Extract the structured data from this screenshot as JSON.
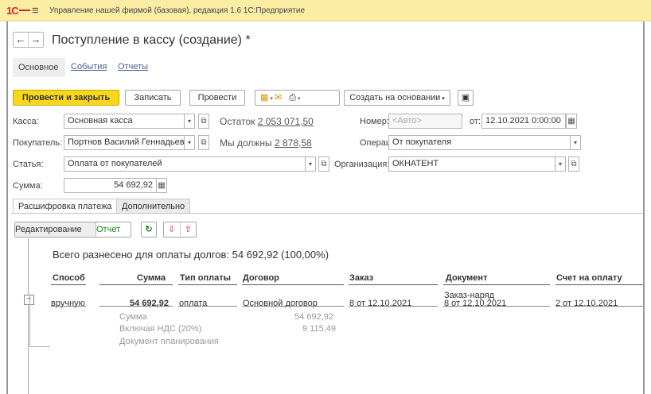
{
  "app": {
    "title": "Управление нашей фирмой (базовая), редакция 1.6 1С:Предприятие",
    "logo": "1С"
  },
  "nav": {
    "back": "←",
    "forward": "→"
  },
  "document": {
    "title": "Поступление в кассу (создание) *"
  },
  "tabs": [
    "Основное",
    "События",
    "Отчеты"
  ],
  "toolbar": {
    "post_close": "Провести и закрыть",
    "save": "Записать",
    "post": "Провести",
    "create_based": "Создать на основании"
  },
  "form": {
    "cash_label": "Касса:",
    "cash_value": "Основная касса",
    "balance_label": "Остаток",
    "balance_value": "2 053 071,50",
    "number_label": "Номер:",
    "number_placeholder": "<Авто>",
    "date_label": "от:",
    "date_value": "12.10.2021  0:00:00",
    "buyer_label": "Покупатель:",
    "buyer_value": "Портнов Василий Геннадьевич",
    "debt_label": "Мы должны",
    "debt_value": "2 878,58",
    "operation_label": "Операция:",
    "operation_value": "От покупателя",
    "item_label": "Статья:",
    "item_value": "Оплата от покупателей",
    "org_label": "Организация:",
    "org_value": "ОКНАТЕНТ",
    "sum_label": "Сумма:",
    "sum_value": "54 692,92"
  },
  "payment_tabs": [
    "Расшифровка платежа",
    "Дополнительно"
  ],
  "payment_toolbar": {
    "edit": "Редактирование",
    "report": "Отчет"
  },
  "allocation": {
    "summary": "Всего разнесено для оплаты долгов: 54 692,92  (100,00%)",
    "columns": [
      "Способ",
      "Сумма",
      "Тип оплаты",
      "Договор",
      "Заказ",
      "Документ",
      "Счет на оплату"
    ],
    "row": {
      "method": "вручную",
      "sum": "54 692,92",
      "pay_type": "оплата",
      "contract": "Основной договор",
      "order": "8 от 12.10.2021",
      "document_type": "Заказ-наряд",
      "document": "8 от 12.10.2021",
      "invoice": "2 от 12.10.2021"
    },
    "details": {
      "sum_label": "Сумма",
      "sum_value": "54 692,92",
      "vat_label": "Включая НДС (20%)",
      "vat_value": "9 115,49",
      "plan_label": "Документ планирования"
    }
  }
}
